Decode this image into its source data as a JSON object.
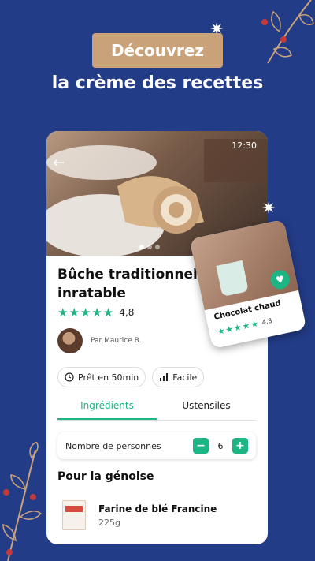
{
  "promo": {
    "badge": "Découvrez",
    "headline": "la crème des recettes"
  },
  "status_bar": {
    "time": "12:30"
  },
  "recipe": {
    "title": "Bûche traditionnelle inratable",
    "stars": "★★★★★",
    "rating": "4,8",
    "author": "Par Maurice B.",
    "time_chip": "Prêt en 50min",
    "difficulty_chip": "Facile"
  },
  "tabs": [
    {
      "label": "Ingrédients",
      "active": true
    },
    {
      "label": "Ustensiles",
      "active": false
    }
  ],
  "persons": {
    "label": "Nombre de personnes",
    "minus": "−",
    "count": "6",
    "plus": "+"
  },
  "section_title": "Pour la génoise",
  "ingredients": [
    {
      "name": "Farine de blé Francine",
      "qty": "225g"
    }
  ],
  "second_card": {
    "title": "Chocolat chaud",
    "stars": "★★★★★",
    "rating": "4,8"
  },
  "colors": {
    "background": "#233c87",
    "accent": "#1db584",
    "badge": "#c9a27a"
  }
}
